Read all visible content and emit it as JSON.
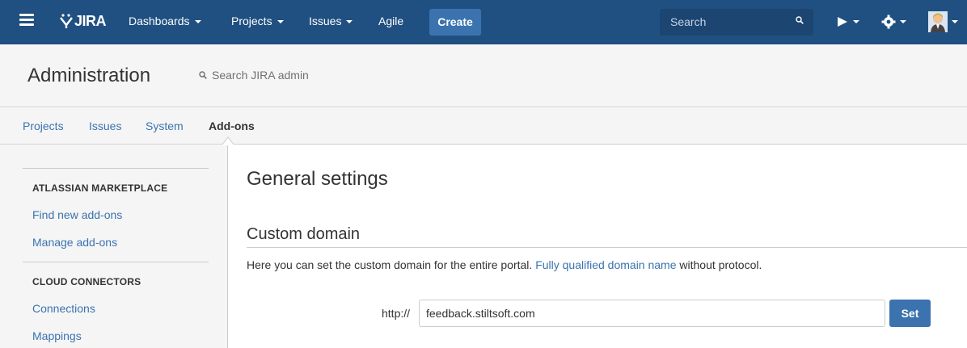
{
  "header": {
    "logo_text": "JIRA",
    "nav": [
      {
        "label": "Dashboards"
      },
      {
        "label": "Projects"
      },
      {
        "label": "Issues"
      },
      {
        "label": "Agile"
      }
    ],
    "create_label": "Create",
    "search_placeholder": "Search",
    "colors": {
      "bar": "#205081",
      "create": "#3b73af"
    }
  },
  "admin": {
    "title": "Administration",
    "search_placeholder": "Search JIRA admin"
  },
  "tabs": [
    {
      "label": "Projects",
      "active": false
    },
    {
      "label": "Issues",
      "active": false
    },
    {
      "label": "System",
      "active": false
    },
    {
      "label": "Add-ons",
      "active": true
    }
  ],
  "sidebar": {
    "sections": [
      {
        "heading": "ATLASSIAN MARKETPLACE",
        "items": [
          {
            "label": "Find new add-ons"
          },
          {
            "label": "Manage add-ons"
          }
        ]
      },
      {
        "heading": "CLOUD CONNECTORS",
        "items": [
          {
            "label": "Connections"
          },
          {
            "label": "Mappings"
          }
        ]
      }
    ]
  },
  "main": {
    "title": "General settings",
    "section_title": "Custom domain",
    "description_before": "Here you can set the custom domain for the entire portal.",
    "description_link": "Fully qualified domain name",
    "description_after": "without protocol.",
    "prefix_label": "http://",
    "domain_value": "feedback.stiltsoft.com",
    "set_label": "Set"
  }
}
